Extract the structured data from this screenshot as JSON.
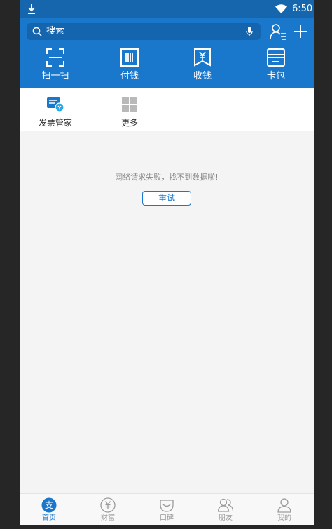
{
  "status_bar": {
    "time": "6:50",
    "download_icon": "download-icon",
    "wifi_icon": "wifi-icon"
  },
  "header": {
    "search": {
      "placeholder": "搜索",
      "icon": "search-icon",
      "voice_icon": "mic-icon"
    },
    "contacts_icon": "contacts-icon",
    "add_icon": "plus-icon",
    "quick_actions": [
      {
        "label": "扫一扫",
        "icon": "scan-icon"
      },
      {
        "label": "付钱",
        "icon": "barcode-icon"
      },
      {
        "label": "收钱",
        "icon": "yuan-receipt-icon"
      },
      {
        "label": "卡包",
        "icon": "card-wallet-icon"
      }
    ]
  },
  "apps": [
    {
      "label": "发票管家",
      "icon": "invoice-icon"
    },
    {
      "label": "更多",
      "icon": "grid-icon"
    }
  ],
  "error": {
    "message": "网络请求失败，找不到数据啦!",
    "retry_label": "重试"
  },
  "tabbar": {
    "active_index": 0,
    "tabs": [
      {
        "label": "首页",
        "icon": "home-alipay-icon"
      },
      {
        "label": "财富",
        "icon": "yuan-coin-icon"
      },
      {
        "label": "口碑",
        "icon": "koubei-icon"
      },
      {
        "label": "朋友",
        "icon": "friends-icon"
      },
      {
        "label": "我的",
        "icon": "profile-icon"
      }
    ]
  },
  "colors": {
    "brand_blue": "#1a78cc",
    "status_blue": "#1566ad",
    "background": "#f4f4f4"
  }
}
